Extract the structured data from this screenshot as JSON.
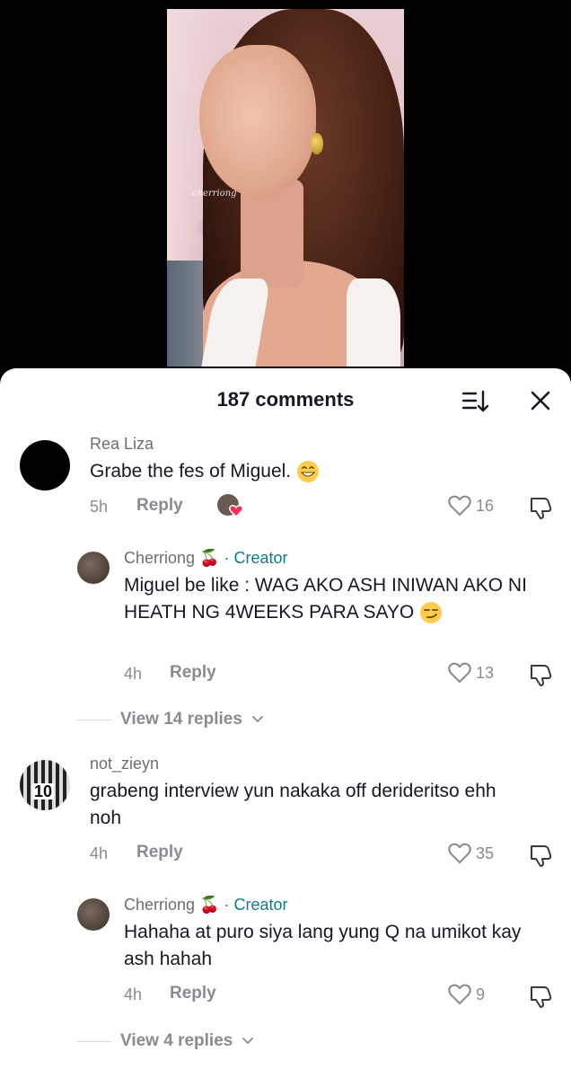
{
  "video": {
    "watermark": "cherriong"
  },
  "sheet": {
    "title": "187 comments"
  },
  "comments": [
    {
      "username": "Rea Liza",
      "text": "Grabe the fes of Miguel.",
      "time": "5h",
      "reply_label": "Reply",
      "likes": "16",
      "reply": {
        "username": "Cherriong",
        "creator_label": "· Creator",
        "text": "Miguel be like : WAG AKO ASH INIWAN AKO NI HEATH NG 4WEEKS PARA SAYO",
        "time": "4h",
        "reply_label": "Reply",
        "likes": "13"
      },
      "view_replies": "View 14 replies"
    },
    {
      "username": "not_zieyn",
      "text": "grabeng interview yun nakaka off derideritso ehh noh",
      "time": "4h",
      "reply_label": "Reply",
      "likes": "35",
      "reply": {
        "username": "Cherriong",
        "creator_label": "· Creator",
        "text": "Hahaha at puro siya lang yung Q na umikot kay ash hahah",
        "time": "4h",
        "reply_label": "Reply",
        "likes": "9"
      },
      "view_replies": "View 4 replies"
    }
  ]
}
